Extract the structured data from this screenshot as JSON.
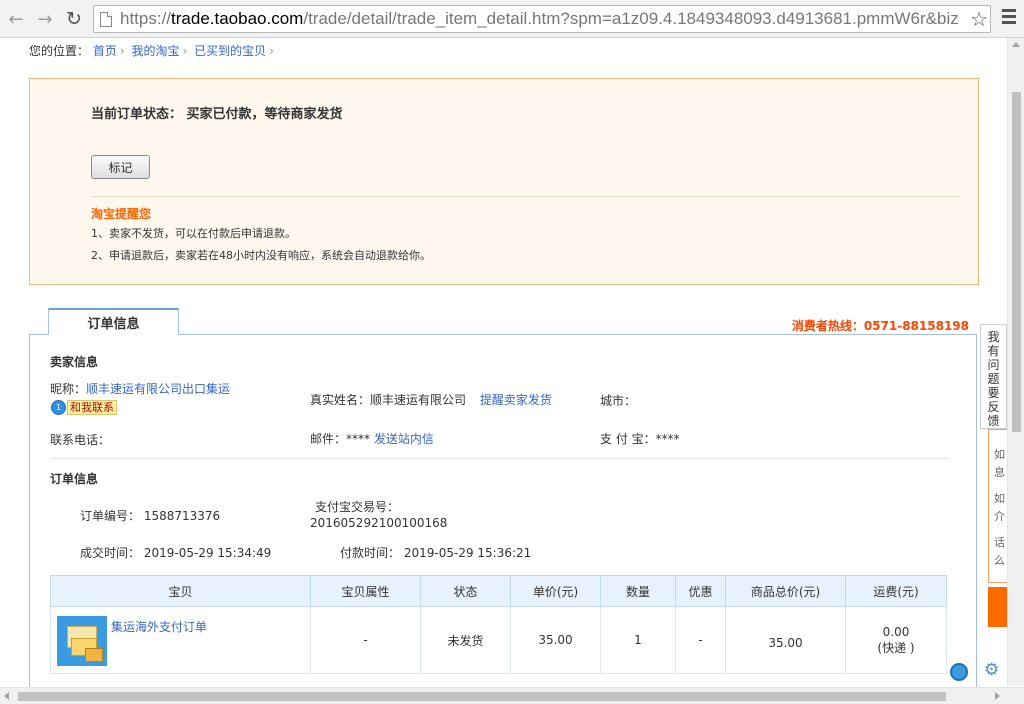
{
  "browser": {
    "url_scheme": "https://",
    "url_host": "trade.taobao.com",
    "url_path": "/trade/detail/trade_item_detail.htm?spm=a1z09.4.1849348093.d4913681.pmmW6r&biz"
  },
  "breadcrumb": {
    "label": "您的位置：",
    "items": [
      "首页",
      "我的淘宝",
      "已买到的宝贝"
    ]
  },
  "status": {
    "line": "当前订单状态： 买家已付款，等待商家发货",
    "mark_button": "标记",
    "tip_title": "淘宝提醒您",
    "tips": [
      "1、卖家不发货，可以在付款后申请退款。",
      "2、申请退款后，卖家若在48小时内没有响应，系统会自动退款给你。"
    ]
  },
  "tab": {
    "label": "订单信息"
  },
  "hotline": "消费者热线：0571-88158198",
  "seller": {
    "title": "卖家信息",
    "nickname_label": "昵称：",
    "nickname": "顺丰速运有限公司出口集运",
    "contact_label": "和我联系",
    "realname_label": "真实姓名：",
    "realname": "顺丰速运有限公司",
    "remind_link": "提醒卖家发货",
    "city_label": "城市：",
    "phone_label": "联系电话：",
    "email_label": "邮件：****",
    "email_link": "发送站内信",
    "alipay_label": "支 付 宝：****"
  },
  "order": {
    "title": "订单信息",
    "number_label": "订单编号：",
    "number": "1588713376",
    "alipay_trade_label": "支付宝交易号：",
    "alipay_trade_no": "201605292100100168",
    "deal_time_label": "成交时间：",
    "deal_time": "2019-05-29 15:34:49",
    "pay_time_label": "付款时间：",
    "pay_time": "2019-05-29 15:36:21"
  },
  "items_table": {
    "headers": [
      "宝贝",
      "宝贝属性",
      "状态",
      "单价(元)",
      "数量",
      "优惠",
      "商品总价(元)",
      "运费(元)"
    ],
    "rows": [
      {
        "name": "集运海外支付订单",
        "attr": "-",
        "status": "未发货",
        "price": "35.00",
        "qty": "1",
        "discount": "-",
        "total": "35.00",
        "shipping": "0.00",
        "shipping_method": "(快递 )"
      }
    ]
  },
  "feedback": {
    "chars": [
      "我",
      "有",
      "问",
      "题",
      "要",
      "反",
      "馈"
    ],
    "side_chars": [
      "如",
      "息",
      "如",
      "介",
      "话",
      "么"
    ]
  }
}
